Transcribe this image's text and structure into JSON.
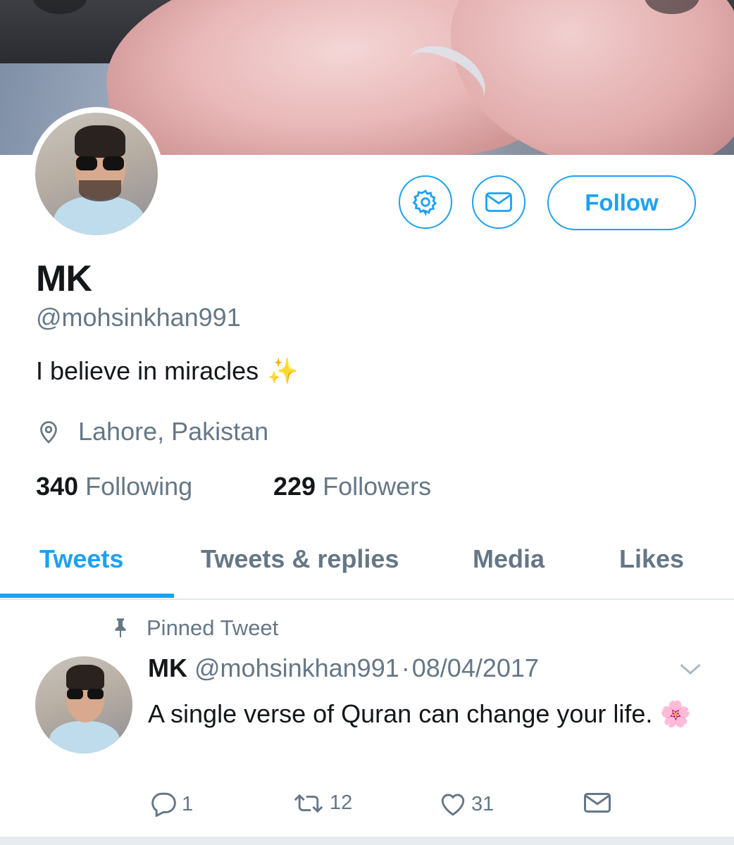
{
  "profile": {
    "display_name": "MK",
    "handle": "@mohsinkhan991",
    "bio": "I believe in miracles",
    "bio_emoji": "✨",
    "location": "Lahore, Pakistan",
    "following_count": "340",
    "following_label": "Following",
    "followers_count": "229",
    "followers_label": "Followers"
  },
  "actions": {
    "settings_icon": "gear-icon",
    "message_icon": "envelope-icon",
    "follow_label": "Follow"
  },
  "tabs": [
    {
      "label": "Tweets",
      "active": true
    },
    {
      "label": "Tweets & replies",
      "active": false
    },
    {
      "label": "Media",
      "active": false
    },
    {
      "label": "Likes",
      "active": false
    }
  ],
  "pinned_tweet": {
    "pin_label": "Pinned Tweet",
    "author_name": "MK",
    "author_handle": "@mohsinkhan991",
    "separator": "·",
    "date": "08/04/2017",
    "text": "A single verse of Quran can change your life.",
    "emoji": "🌸",
    "reply_count": "1",
    "retweet_count": "12",
    "like_count": "31"
  },
  "colors": {
    "accent": "#1da1f2",
    "secondary_text": "#657786",
    "primary_text": "#14171a",
    "divider": "#e1e8ed"
  }
}
